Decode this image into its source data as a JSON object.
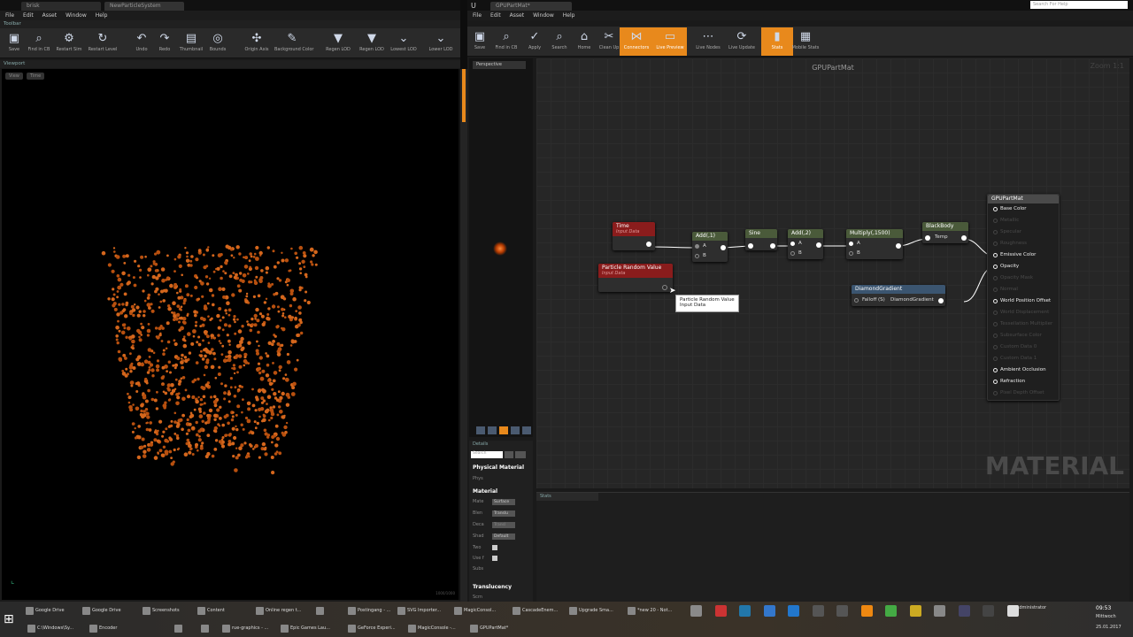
{
  "left_window": {
    "tabs": [
      "brisk",
      "NewParticleSystem"
    ],
    "menu": [
      "File",
      "Edit",
      "Asset",
      "Window",
      "Help"
    ],
    "toolbar_header": "Toolbar",
    "toolbar": [
      {
        "label": "Save",
        "icon": "save-icon"
      },
      {
        "label": "Find in CB",
        "icon": "search-icon"
      },
      {
        "label": "Restart Sim",
        "icon": "gear-icon"
      },
      {
        "label": "Restart Level",
        "icon": "refresh-icon"
      },
      {
        "label": "Undo",
        "icon": "undo-icon"
      },
      {
        "label": "Redo",
        "icon": "redo-icon"
      },
      {
        "label": "Thumbnail",
        "icon": "image-icon"
      },
      {
        "label": "Bounds",
        "icon": "bounds-icon"
      },
      {
        "label": "Origin Axis",
        "icon": "axis-icon"
      },
      {
        "label": "Background Color",
        "icon": "brush-icon"
      },
      {
        "label": "Regen LOD",
        "icon": "lod-icon"
      },
      {
        "label": "Regen LOD",
        "icon": "lod-icon"
      },
      {
        "label": "Lowest LOD",
        "icon": "lod-down-icon"
      },
      {
        "label": "Lower LOD",
        "icon": "lod-down-icon"
      }
    ],
    "viewport_header": "Viewport",
    "viewport_buttons": [
      "View",
      "Time"
    ],
    "viewport_stats": "1000/1000"
  },
  "right_window": {
    "tab": "GPUPartMat*",
    "menu": [
      "File",
      "Edit",
      "Asset",
      "Window",
      "Help"
    ],
    "search_placeholder": "Search For Help",
    "toolbar": [
      {
        "label": "Save",
        "icon": "save-icon",
        "active": false
      },
      {
        "label": "Find in CB",
        "icon": "search-icon",
        "active": false
      },
      {
        "label": "Apply",
        "icon": "check-icon",
        "active": false
      },
      {
        "label": "Search",
        "icon": "binoculars-icon",
        "active": false
      },
      {
        "label": "Home",
        "icon": "home-icon",
        "active": false
      },
      {
        "label": "Clean Up",
        "icon": "broom-icon",
        "active": false
      },
      {
        "label": "Connectors",
        "icon": "connectors-icon",
        "active": true
      },
      {
        "label": "Live Preview",
        "icon": "monitor-icon",
        "active": true
      },
      {
        "label": "Live Nodes",
        "icon": "nodes-icon",
        "active": false
      },
      {
        "label": "Live Update",
        "icon": "update-icon",
        "active": false
      },
      {
        "label": "Stats",
        "icon": "stats-icon",
        "active": true
      },
      {
        "label": "Mobile Stats",
        "icon": "mobile-stats-icon",
        "active": false
      }
    ],
    "preview_button": "Perspective",
    "graph_title": "GPUPartMat",
    "zoom": "Zoom 1:1",
    "watermark": "MATERIAL",
    "stats_tab": "Stats",
    "details_tab": "Details",
    "details_search_placeholder": "Search",
    "details": {
      "physical_section": "Physical Material",
      "phys_label": "Phys",
      "material_section": "Material",
      "rows": [
        {
          "label": "Mate",
          "value": "Surface"
        },
        {
          "label": "Blen",
          "value": "Translu"
        },
        {
          "label": "Deca",
          "value": "Transl"
        },
        {
          "label": "Shad",
          "value": "Default"
        }
      ],
      "checks": [
        "Two",
        "Use f"
      ],
      "subs_label": "Subs",
      "translucency_section": "Translucency",
      "scrn_label": "Scrn"
    },
    "nodes": {
      "time": {
        "title": "Time",
        "sub": "Input Data"
      },
      "particle": {
        "title": "Particle Random Value",
        "sub": "Input Data"
      },
      "add1": {
        "title": "Add(,1)",
        "pins": [
          "A",
          "B"
        ]
      },
      "sine": {
        "title": "Sine"
      },
      "add2": {
        "title": "Add(,2)",
        "pins": [
          "A",
          "B"
        ]
      },
      "multiply": {
        "title": "Multiply(,1500)",
        "pins": [
          "A",
          "B"
        ]
      },
      "blackbody": {
        "title": "BlackBody",
        "pin": "Temp"
      },
      "diamond": {
        "title": "DiamondGradient",
        "input": "Falloff (S)",
        "output": "DiamondGradient"
      },
      "tooltip": {
        "line1": "Particle Random Value",
        "line2": "Input Data"
      }
    },
    "material_node": {
      "title": "GPUPartMat",
      "inputs": [
        {
          "label": "Base Color",
          "active": true
        },
        {
          "label": "Metallic",
          "active": false
        },
        {
          "label": "Specular",
          "active": false
        },
        {
          "label": "Roughness",
          "active": false
        },
        {
          "label": "Emissive Color",
          "active": true
        },
        {
          "label": "Opacity",
          "active": true
        },
        {
          "label": "Opacity Mask",
          "active": false
        },
        {
          "label": "Normal",
          "active": false
        },
        {
          "label": "World Position Offset",
          "active": true
        },
        {
          "label": "World Displacement",
          "active": false
        },
        {
          "label": "Tessellation Multiplier",
          "active": false
        },
        {
          "label": "Subsurface Color",
          "active": false
        },
        {
          "label": "Custom Data 0",
          "active": false
        },
        {
          "label": "Custom Data 1",
          "active": false
        },
        {
          "label": "Ambient Occlusion",
          "active": true
        },
        {
          "label": "Refraction",
          "active": true
        },
        {
          "label": "Pixel Depth Offset",
          "active": false
        }
      ]
    }
  },
  "taskbar": {
    "row1": [
      "Google Drive",
      "Google Drive",
      "Screenshots",
      "Content",
      "Online regen t...",
      "",
      "Postingang - ...",
      "SVG Importer...",
      "MagicConsol...",
      "CascadeEnem...",
      "Upgrade Sma...",
      "*new 20 - Not..."
    ],
    "row2": [
      "C:\\Windows\\Sy...",
      "Encoder",
      "",
      "",
      "rue-graphics - ...",
      "Epic Games Lau...",
      "GeForce Experi...",
      "MagicConsole -...",
      "GPUPartMat*"
    ],
    "user": "Administrator",
    "time": "09:53",
    "weekday": "Mittwoch",
    "date": "25.01.2017"
  }
}
